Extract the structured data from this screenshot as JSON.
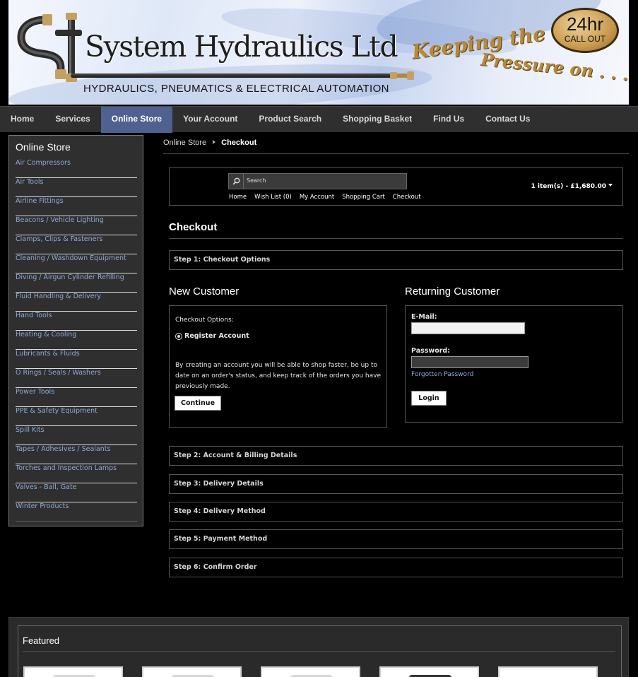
{
  "header": {
    "company_name": "System Hydraulics Ltd",
    "tagline": "HYDRAULICS, PNEUMATICS & ELECTRICAL AUTOMATION",
    "slogan_line1": "Keeping the",
    "slogan_line2": "Pressure on . . .",
    "badge_top": "24hr",
    "badge_bottom": "CALL OUT"
  },
  "main_nav": [
    {
      "label": "Home"
    },
    {
      "label": "Services"
    },
    {
      "label": "Online Store",
      "active": true
    },
    {
      "label": "Your Account"
    },
    {
      "label": "Product Search"
    },
    {
      "label": "Shopping Basket"
    },
    {
      "label": "Find Us"
    },
    {
      "label": "Contact Us"
    }
  ],
  "sidebar": {
    "title": "Online Store",
    "items": [
      "Air Compressors",
      "Air Tools",
      "Airline Fittings",
      "Beacons / Vehicle Lighting",
      "Clamps, Clips & Fasteners",
      "Cleaning / Washdown Equipment",
      "Diving / Airgun Cylinder Refilling",
      "Fluid Handling & Delivery",
      "Hand Tools",
      "Heating & Cooling",
      "Lubricants & Fluids",
      "O Rings / Seals / Washers",
      "Power Tools",
      "PPE & Safety Equipment",
      "Spill Kits",
      "Tapes / Adhesives / Sealants",
      "Torches and Inspection Lamps",
      "Valves - Ball, Gate",
      "Winter Products"
    ]
  },
  "breadcrumb": {
    "parent": "Online Store",
    "current": "Checkout"
  },
  "store_header": {
    "search_placeholder": "Search",
    "links": [
      "Home",
      "Wish List (0)",
      "My Account",
      "Shopping Cart",
      "Checkout"
    ],
    "cart_total": "1 item(s) - £1,680.00"
  },
  "checkout": {
    "title": "Checkout",
    "step1": "Step 1: Checkout Options",
    "new_customer": {
      "title": "New Customer",
      "options_label": "Checkout Options:",
      "radio_label": "Register Account",
      "description": "By creating an account you will be able to shop faster, be up to date on an order's status, and keep track of the orders you have previously made.",
      "continue_label": "Continue"
    },
    "returning_customer": {
      "title": "Returning Customer",
      "email_label": "E-Mail:",
      "email_value": "",
      "password_label": "Password:",
      "password_value": "",
      "forgot_label": "Forgotten Password",
      "login_label": "Login"
    },
    "steps": [
      "Step 2: Account & Billing Details",
      "Step 3: Delivery Details",
      "Step 4: Delivery Method",
      "Step 5: Payment Method",
      "Step 6: Confirm Order"
    ]
  },
  "featured": {
    "title": "Featured"
  }
}
